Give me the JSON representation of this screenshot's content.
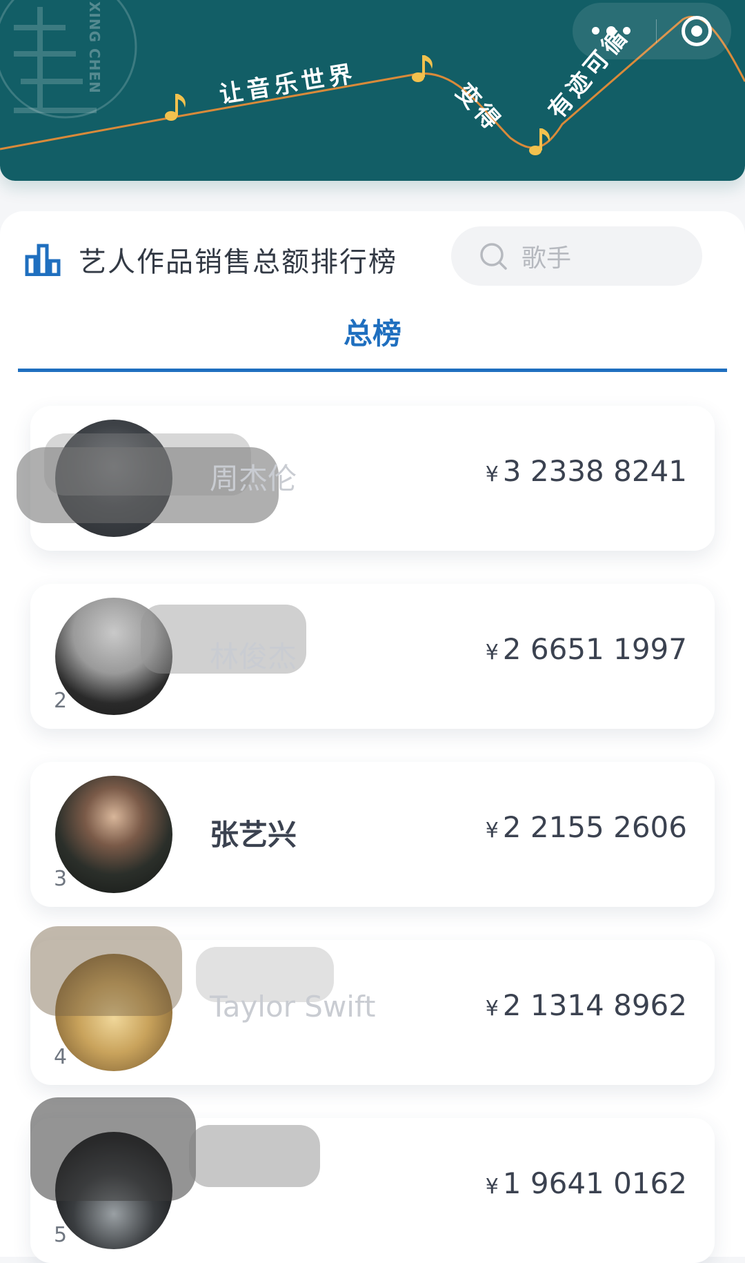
{
  "banner": {
    "logo_text": "XING CHEN",
    "slogan_parts": [
      "让音乐世界",
      "变得",
      "有迹可循"
    ],
    "bg_color": "#125e66",
    "note_color": "#f2c14e",
    "line_color": "#d98a3a"
  },
  "capsule": {
    "more_icon": "more-dots-icon",
    "close_icon": "target-circle-icon"
  },
  "header": {
    "title": "艺人作品销售总额排行榜",
    "icon": "bar-chart-icon",
    "accent": "#1f6fbf"
  },
  "search": {
    "placeholder": "歌手",
    "icon": "search-icon"
  },
  "tabs": [
    {
      "label": "总榜",
      "active": true
    }
  ],
  "ranking": {
    "currency_symbol": "¥",
    "items": [
      {
        "rank": "",
        "name": "周杰伦",
        "amount": "3 2338 8241"
      },
      {
        "rank": "2",
        "name": "林俊杰",
        "amount": "2 6651 1997"
      },
      {
        "rank": "3",
        "name": "张艺兴",
        "amount": "2 2155 2606"
      },
      {
        "rank": "4",
        "name": "Taylor Swift",
        "amount": "2 1314 8962"
      },
      {
        "rank": "5",
        "name": "",
        "amount": "1 9641 0162"
      }
    ]
  }
}
